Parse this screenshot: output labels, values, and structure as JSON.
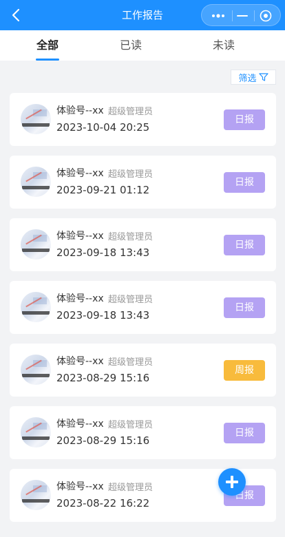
{
  "header": {
    "title": "工作报告",
    "background": "#1e90ff",
    "icons": [
      "back-arrow-icon",
      "more-dots-icon",
      "minimize-icon",
      "close-target-icon"
    ]
  },
  "tabs": [
    {
      "label": "全部",
      "active": true
    },
    {
      "label": "已读",
      "active": false
    },
    {
      "label": "未读",
      "active": false
    }
  ],
  "filter": {
    "label": "筛选",
    "icon": "filter-funnel-icon"
  },
  "colors": {
    "daily": "#b4a2f3",
    "weekly": "#f8bb3c",
    "accent": "#1e90ff"
  },
  "reports": [
    {
      "name": "体验号--xx",
      "role": "超级管理员",
      "time": "2023-10-04 20:25",
      "type": "日报"
    },
    {
      "name": "体验号--xx",
      "role": "超级管理员",
      "time": "2023-09-21 01:12",
      "type": "日报"
    },
    {
      "name": "体验号--xx",
      "role": "超级管理员",
      "time": "2023-09-18 13:43",
      "type": "日报"
    },
    {
      "name": "体验号--xx",
      "role": "超级管理员",
      "time": "2023-09-18 13:43",
      "type": "日报"
    },
    {
      "name": "体验号--xx",
      "role": "超级管理员",
      "time": "2023-08-29 15:16",
      "type": "周报"
    },
    {
      "name": "体验号--xx",
      "role": "超级管理员",
      "time": "2023-08-29 15:16",
      "type": "日报"
    },
    {
      "name": "体验号--xx",
      "role": "超级管理员",
      "time": "2023-08-22 16:22",
      "type": "日报"
    }
  ],
  "fab": {
    "icon": "plus-icon"
  }
}
